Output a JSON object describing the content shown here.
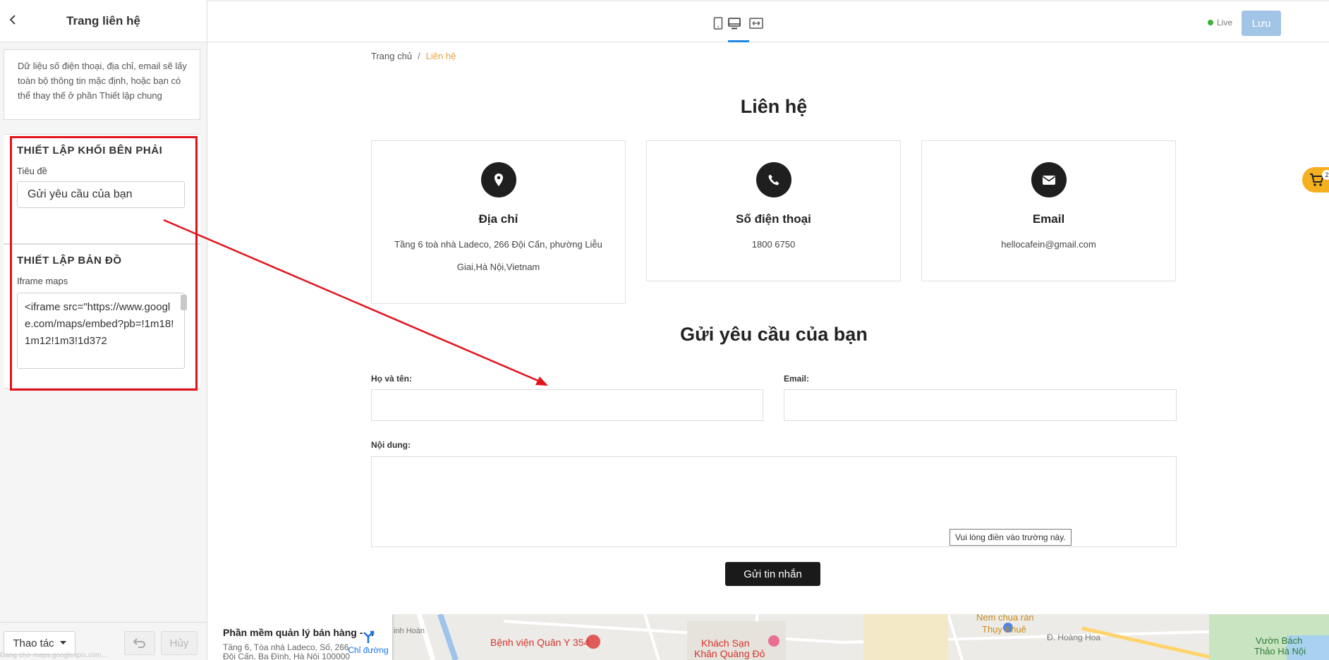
{
  "left_panel": {
    "header_title": "Trang liên hệ",
    "info_text": "Dữ liệu số điện thoại, địa chỉ, email sẽ lấy toàn bộ thông tin mặc định, hoặc bạn có thể thay thế ở phần Thiết lập chung",
    "right_block_section": {
      "title": "THIẾT LẬP KHỐI BÊN PHẢI",
      "field_label": "Tiêu đề",
      "field_value": "Gửi yêu cầu của bạn"
    },
    "map_section": {
      "title": "THIẾT LẬP BẢN ĐỒ",
      "field_label": "Iframe maps",
      "field_value": "<iframe src=\"https://www.google.com/maps/embed?pb=!1m18!1m12!1m3!1d372"
    },
    "footer": {
      "actions_label": "Thao tác",
      "cancel_label": "Hủy",
      "status_text": "Đang chờ maps.googleapis.com..."
    }
  },
  "toolbar": {
    "live_label": "Live",
    "save_label": "Lưu",
    "devices": [
      "mobile-icon",
      "desktop-icon",
      "fullwidth-icon"
    ],
    "active_device": "desktop-icon"
  },
  "preview": {
    "breadcrumb": {
      "home": "Trang chủ",
      "separator": "/",
      "current": "Liên hệ"
    },
    "page_title": "Liên hệ",
    "cards": [
      {
        "icon": "map-pin-icon",
        "title": "Địa chỉ",
        "text": "Tầng 6 toà nhà Ladeco, 266 Đội Cấn, phường Liễu Giai,Hà Nội,Vietnam"
      },
      {
        "icon": "phone-icon",
        "title": "Số điện thoại",
        "text": "1800 6750"
      },
      {
        "icon": "envelope-icon",
        "title": "Email",
        "text": "hellocafein@gmail.com"
      }
    ],
    "form": {
      "title": "Gửi yêu cầu của bạn",
      "name_label": "Họ và tên:",
      "email_label": "Email:",
      "content_label": "Nội dung:",
      "tooltip": "Vui lòng điền vào trường này.",
      "submit_label": "Gửi tin nhắn"
    },
    "cart_count": "2",
    "map": {
      "card_title": "Phần mềm quản lý bán hàng - ...",
      "card_address": "Tầng 6, Tòa nhà Ladeco, Số, 266 Đội Cấn, Ba Đình, Hà Nội 100000",
      "directions_label": "Chỉ đường",
      "labels": [
        "Bệnh viện Quân Y 354",
        "Khách Sạn",
        "Khăn Quàng Đỏ",
        "Nem chua rán",
        "Thụy Khuê",
        "Vườn Bách",
        "Thảo Hà Nội",
        "Đ. Hoàng Hoa",
        "inh Hoàn"
      ]
    }
  },
  "colors": {
    "accent_blue": "#1e88e5",
    "save_button": "#a2c4e6",
    "live_dot": "#38b03b",
    "breadcrumb_current": "#e8a33c",
    "annotation_red": "#e3131b",
    "cart_yellow": "#f5b020",
    "dark_button": "#1a1a1a"
  }
}
